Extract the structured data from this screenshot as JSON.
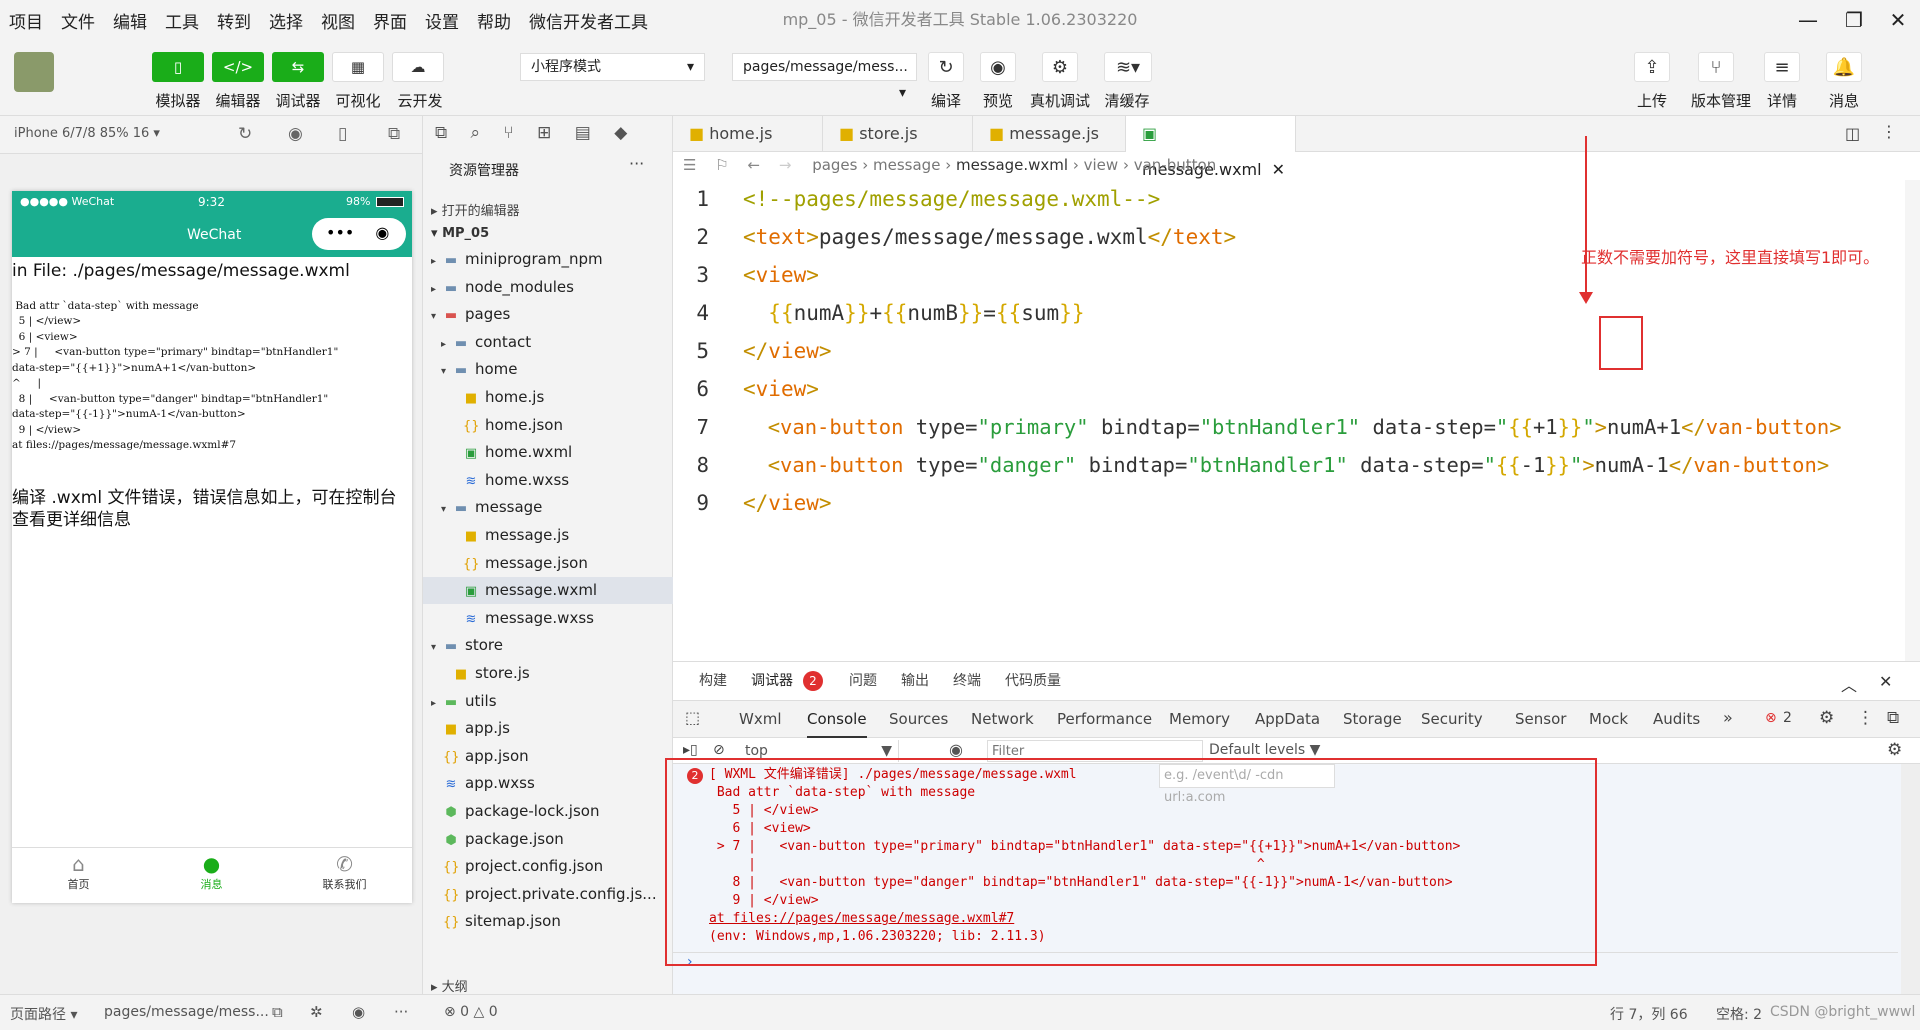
{
  "menu": [
    "项目",
    "文件",
    "编辑",
    "工具",
    "转到",
    "选择",
    "视图",
    "界面",
    "设置",
    "帮助",
    "微信开发者工具"
  ],
  "window_title": "mp_05 - 微信开发者工具 Stable 1.06.2303220",
  "toolbar": {
    "simulator": "模拟器",
    "editor": "编辑器",
    "debugger": "调试器",
    "visual": "可视化",
    "cloud": "云开发",
    "mode": "小程序模式",
    "page_select": "pages/message/mess...",
    "compile": "编译",
    "preview": "预览",
    "device_debug": "真机调试",
    "clear_cache": "清缓存",
    "upload": "上传",
    "version": "版本管理",
    "details": "详情",
    "messages": "消息"
  },
  "sim": {
    "device": "iPhone 6/7/8 85% 16 ▾",
    "carrier": "●●●●● WeChat",
    "time": "9:32",
    "battery": "98%",
    "nav_title": "WeChat",
    "err_title": "in File: ./pages/message/message.wxml",
    "err_lines": [
      " Bad attr `data-step` with message",
      "  5 | </view>",
      "  6 | <view>",
      "> 7 |     <van-button type=\"primary\" bindtap=\"btnHandler1\"",
      "data-step=\"{{+1}}\">numA+1</van-button>",
      "^     |",
      "  8 |     <van-button type=\"danger\" bindtap=\"btnHandler1\"",
      "data-step=\"{{-1}}\">numA-1</van-button>",
      "  9 | </view>",
      "at files://pages/message/message.wxml#7"
    ],
    "err_msg": "编译 .wxml 文件错误，错误信息如上，可在控制台查看更详细信息",
    "tabs": [
      "首页",
      "消息",
      "联系我们"
    ]
  },
  "explorer": {
    "title": "资源管理器",
    "open_editors": "打开的编辑器",
    "project": "MP_05",
    "items": [
      {
        "label": "miniprogram_npm",
        "icon": "folder",
        "depth": 1,
        "arrow": "▸"
      },
      {
        "label": "node_modules",
        "icon": "folder",
        "depth": 1,
        "arrow": "▸"
      },
      {
        "label": "pages",
        "icon": "folder-red",
        "depth": 1,
        "arrow": "▾"
      },
      {
        "label": "contact",
        "icon": "folder",
        "depth": 2,
        "arrow": "▸"
      },
      {
        "label": "home",
        "icon": "folder",
        "depth": 2,
        "arrow": "▾"
      },
      {
        "label": "home.js",
        "icon": "js",
        "depth": 3,
        "arrow": ""
      },
      {
        "label": "home.json",
        "icon": "json",
        "depth": 3,
        "arrow": ""
      },
      {
        "label": "home.wxml",
        "icon": "wxml",
        "depth": 3,
        "arrow": ""
      },
      {
        "label": "home.wxss",
        "icon": "wxss",
        "depth": 3,
        "arrow": ""
      },
      {
        "label": "message",
        "icon": "folder",
        "depth": 2,
        "arrow": "▾"
      },
      {
        "label": "message.js",
        "icon": "js",
        "depth": 3,
        "arrow": ""
      },
      {
        "label": "message.json",
        "icon": "json",
        "depth": 3,
        "arrow": ""
      },
      {
        "label": "message.wxml",
        "icon": "wxml",
        "depth": 3,
        "arrow": "",
        "selected": true
      },
      {
        "label": "message.wxss",
        "icon": "wxss",
        "depth": 3,
        "arrow": ""
      },
      {
        "label": "store",
        "icon": "folder",
        "depth": 1,
        "arrow": "▾"
      },
      {
        "label": "store.js",
        "icon": "js",
        "depth": 2,
        "arrow": ""
      },
      {
        "label": "utils",
        "icon": "folder-green",
        "depth": 1,
        "arrow": "▸"
      },
      {
        "label": "app.js",
        "icon": "js",
        "depth": 1,
        "arrow": ""
      },
      {
        "label": "app.json",
        "icon": "json",
        "depth": 1,
        "arrow": ""
      },
      {
        "label": "app.wxss",
        "icon": "wxss",
        "depth": 1,
        "arrow": ""
      },
      {
        "label": "package-lock.json",
        "icon": "pkg",
        "depth": 1,
        "arrow": ""
      },
      {
        "label": "package.json",
        "icon": "pkg",
        "depth": 1,
        "arrow": ""
      },
      {
        "label": "project.config.json",
        "icon": "json",
        "depth": 1,
        "arrow": ""
      },
      {
        "label": "project.private.config.js...",
        "icon": "json",
        "depth": 1,
        "arrow": ""
      },
      {
        "label": "sitemap.json",
        "icon": "json",
        "depth": 1,
        "arrow": ""
      }
    ],
    "outline": "大纲"
  },
  "editor": {
    "tabs": [
      "home.js",
      "store.js",
      "message.js",
      "message.wxml"
    ],
    "breadcrumb": [
      "pages",
      "message",
      "message.wxml",
      "view",
      "van-button"
    ],
    "annotation": "正数不需要加符号，这里直接填写1即可。"
  },
  "devtools": {
    "top_tabs": [
      "构建",
      "调试器",
      "问题",
      "输出",
      "终端",
      "代码质量"
    ],
    "badge": "2",
    "tabs": [
      "Wxml",
      "Console",
      "Sources",
      "Network",
      "Performance",
      "Memory",
      "AppData",
      "Storage",
      "Security",
      "Sensor",
      "Mock",
      "Audits"
    ],
    "context": "top",
    "filter_placeholder": "Filter",
    "filter_hint": "e.g. /event\\d/ -cdn url:a.com",
    "levels": "Default levels ▼",
    "error_count": "2",
    "console_lines": [
      "[ WXML 文件编译错误] ./pages/message/message.wxml",
      " Bad attr `data-step` with message",
      "   5 | </view>",
      "   6 | <view>",
      " > 7 |   <van-button type=\"primary\" bindtap=\"btnHandler1\" data-step=\"{{+1}}\">numA+1</van-button>",
      "     |                                                                ^",
      "   8 |   <van-button type=\"danger\" bindtap=\"btnHandler1\" data-step=\"{{-1}}\">numA-1</van-button>",
      "   9 | </view>",
      "at files://pages/message/message.wxml#7",
      "(env: Windows,mp,1.06.2303220; lib: 2.11.3)"
    ]
  },
  "status": {
    "page_path_label": "页面路径 ▾",
    "page_path": "pages/message/mess...",
    "errors": "⊗ 0 △ 0",
    "cursor": "行 7，列 66",
    "indent": "空格: 2",
    "watermark": "CSDN @bright_wwwl"
  }
}
